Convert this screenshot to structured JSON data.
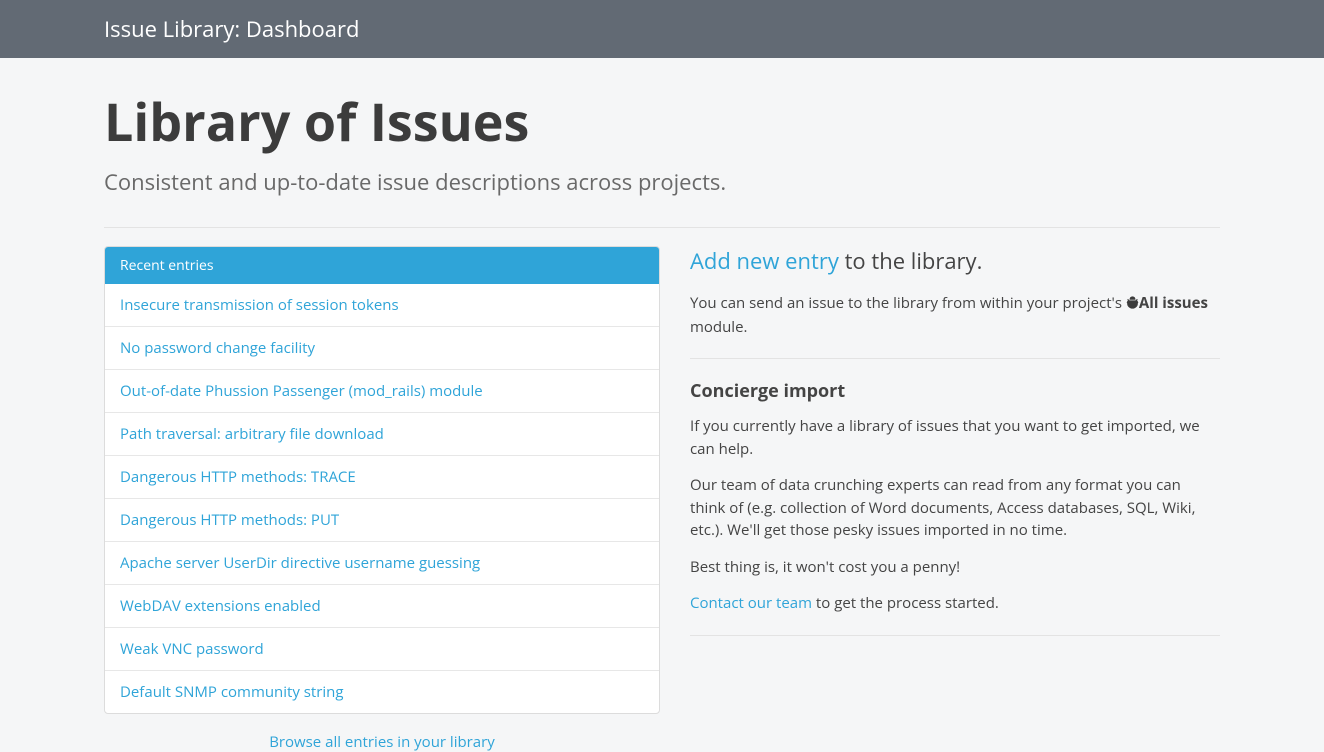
{
  "topbar": {
    "title": "Issue Library: Dashboard"
  },
  "page": {
    "title": "Library of Issues",
    "subtitle": "Consistent and up-to-date issue descriptions across projects."
  },
  "recent": {
    "header": "Recent entries",
    "items": [
      "Insecure transmission of session tokens",
      "No password change facility",
      "Out-of-date Phussion Passenger (mod_rails) module",
      "Path traversal: arbitrary file download",
      "Dangerous HTTP methods: TRACE",
      "Dangerous HTTP methods: PUT",
      "Apache server UserDir directive username guessing",
      "WebDAV extensions enabled",
      "Weak VNC password",
      "Default SNMP community string"
    ],
    "browse_all": "Browse all entries in your library"
  },
  "sidebar": {
    "add_link": "Add new entry",
    "add_suffix": " to the library.",
    "send_prefix": "You can send an issue to the library from within your project's ",
    "all_issues": "All issues",
    "send_suffix": " module.",
    "concierge_heading": "Concierge import",
    "p1": "If you currently have a library of issues that you want to get imported, we can help.",
    "p2": "Our team of data crunching experts can read from any format you can think of (e.g. collection of Word documents, Access databases, SQL, Wiki, etc.). We'll get those pesky issues imported in no time.",
    "p3": "Best thing is, it won't cost you a penny!",
    "contact_link": "Contact our team",
    "contact_suffix": " to get the process started."
  }
}
